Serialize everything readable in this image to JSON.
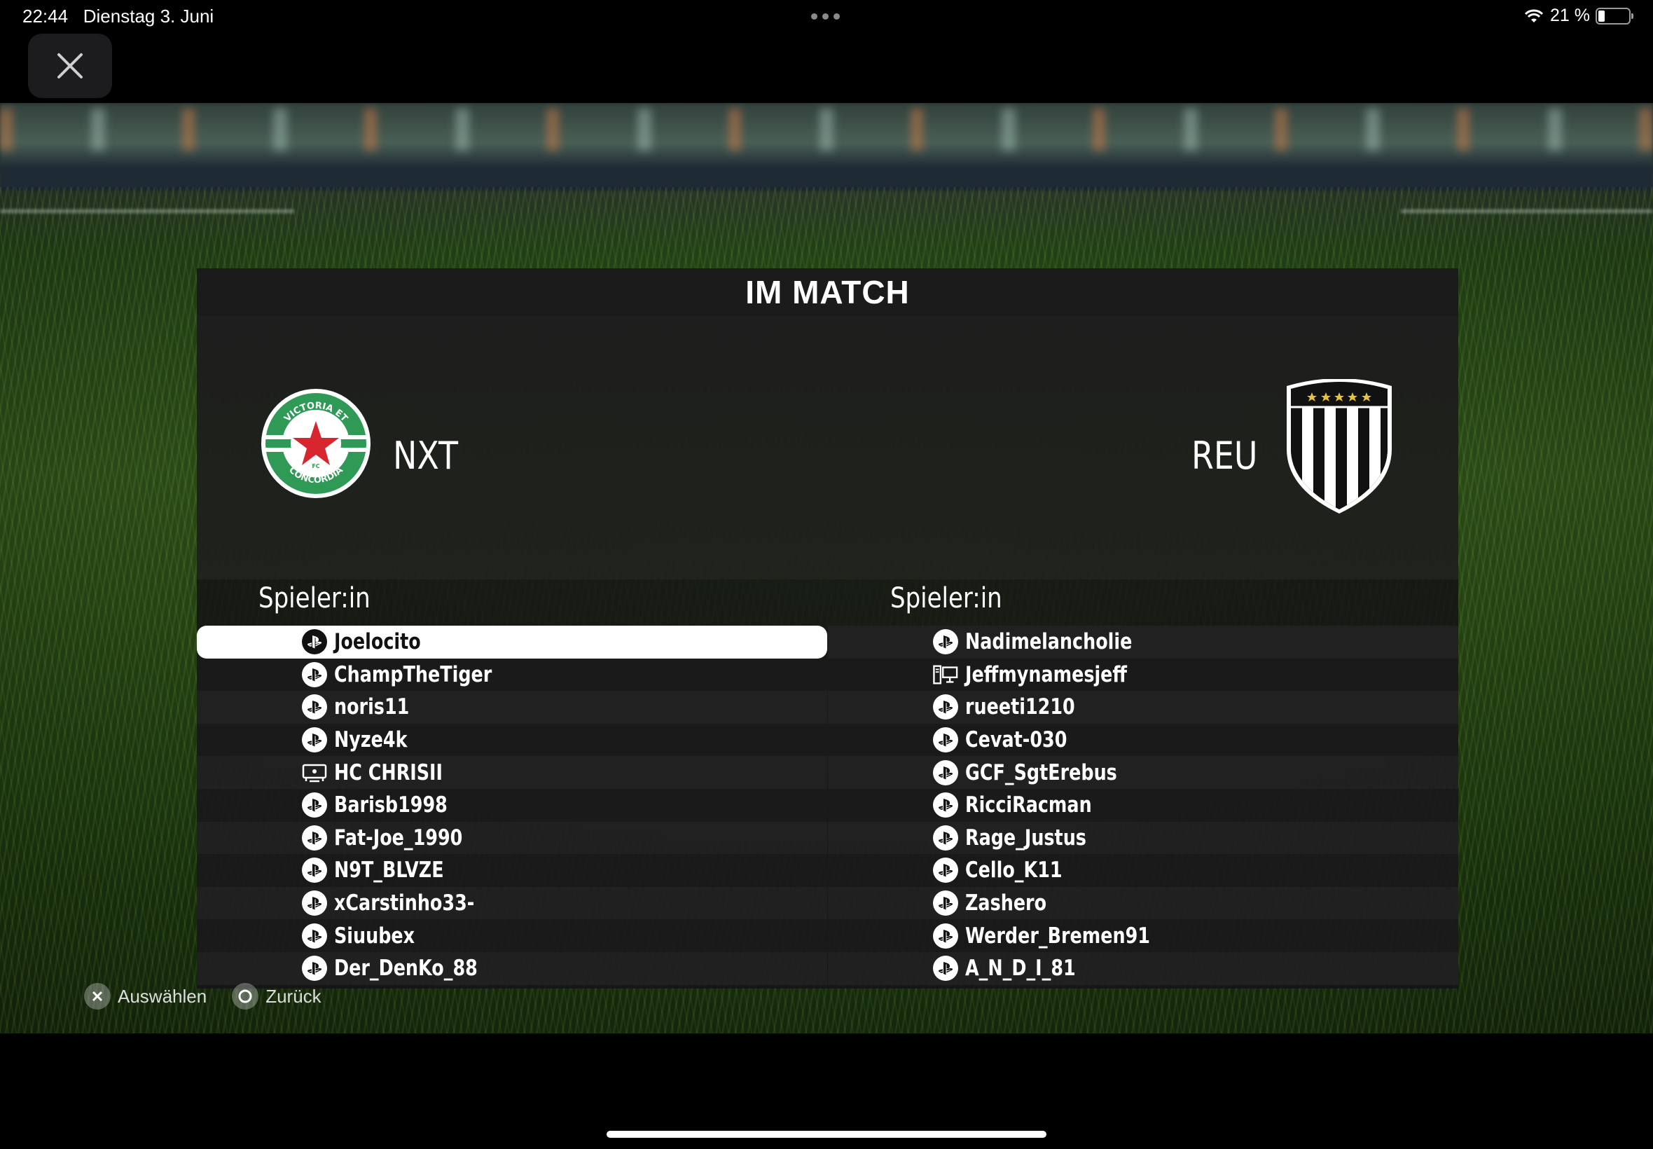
{
  "status_bar": {
    "time": "22:44",
    "date": "Dienstag 3. Juni",
    "battery": "21 %",
    "battery_level": 0.21
  },
  "panel": {
    "title": "IM MATCH"
  },
  "home_team": {
    "abbr": "NXT",
    "crest_text_top": "VICTORIA ET",
    "crest_text_bottom": "CONCORDIA",
    "crest_center": "FC",
    "column_header": "Spieler:in",
    "players": [
      {
        "name": "Joelocito",
        "platform": "playstation"
      },
      {
        "name": "ChampTheTiger",
        "platform": "playstation"
      },
      {
        "name": "noris11",
        "platform": "playstation"
      },
      {
        "name": "Nyze4k",
        "platform": "playstation"
      },
      {
        "name": "HC CHRISII",
        "platform": "xbox"
      },
      {
        "name": "Barisb1998",
        "platform": "playstation"
      },
      {
        "name": "Fat-Joe_1990",
        "platform": "playstation"
      },
      {
        "name": "N9T_BLVZE",
        "platform": "playstation"
      },
      {
        "name": "xCarstinho33-",
        "platform": "playstation"
      },
      {
        "name": "Siuubex",
        "platform": "playstation"
      },
      {
        "name": "Der_DenKo_88",
        "platform": "playstation"
      }
    ]
  },
  "away_team": {
    "abbr": "REU",
    "column_header": "Spieler:in",
    "players": [
      {
        "name": "Nadimelancholie",
        "platform": "playstation"
      },
      {
        "name": "Jeffmynamesjeff",
        "platform": "pc"
      },
      {
        "name": "rueeti1210",
        "platform": "playstation"
      },
      {
        "name": "Cevat-030",
        "platform": "playstation"
      },
      {
        "name": "GCF_SgtErebus",
        "platform": "playstation"
      },
      {
        "name": "RicciRacman",
        "platform": "playstation"
      },
      {
        "name": "Rage_Justus",
        "platform": "playstation"
      },
      {
        "name": "Cello_K11",
        "platform": "playstation"
      },
      {
        "name": "Zashero",
        "platform": "playstation"
      },
      {
        "name": "Werder_Bremen91",
        "platform": "playstation"
      },
      {
        "name": "A_N_D_I_81",
        "platform": "playstation"
      }
    ]
  },
  "footer": {
    "select_label": "Auswählen",
    "back_label": "Zurück"
  },
  "colors": {
    "panel_bg": "#141414",
    "crest_green": "#2e9a55",
    "crest_red": "#d8262e",
    "selected_row": "#ffffff"
  }
}
